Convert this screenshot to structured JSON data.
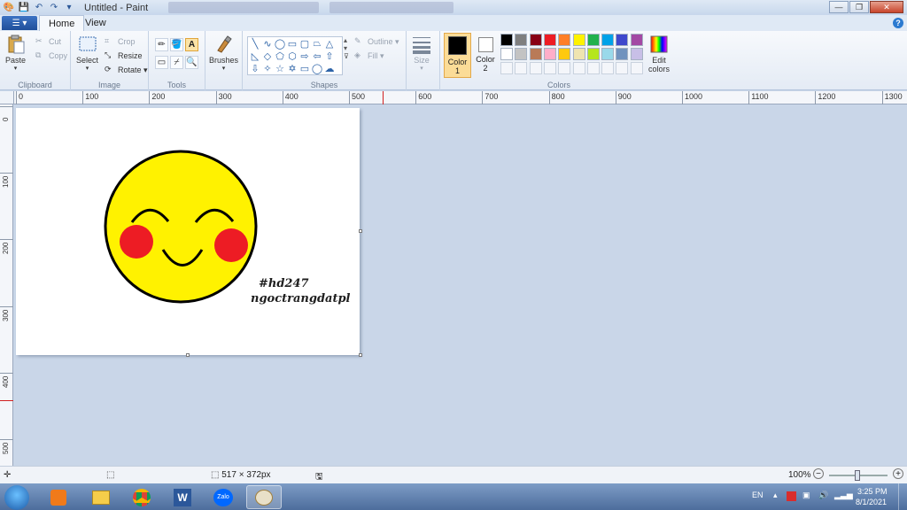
{
  "window": {
    "title": "Untitled - Paint"
  },
  "tabs": {
    "file_label": "▾",
    "home": "Home",
    "view": "View"
  },
  "ribbon": {
    "clipboard": {
      "label": "Clipboard",
      "paste": "Paste",
      "cut": "Cut",
      "copy": "Copy"
    },
    "image": {
      "label": "Image",
      "select": "Select",
      "crop": "Crop",
      "resize": "Resize",
      "rotate": "Rotate"
    },
    "tools": {
      "label": "Tools"
    },
    "brushes": {
      "label": "Brushes"
    },
    "shapes": {
      "label": "Shapes",
      "outline": "Outline",
      "fill": "Fill"
    },
    "size": {
      "label": "Size"
    },
    "colors": {
      "label": "Colors",
      "color1": "Color",
      "color1_num": "1",
      "color2": "Color",
      "color2_num": "2",
      "edit": "Edit",
      "edit2": "colors",
      "color1_value": "#000000",
      "color2_value": "#ffffff",
      "palette": [
        "#000000",
        "#7f7f7f",
        "#880015",
        "#ed1c24",
        "#ff7f27",
        "#fff200",
        "#22b14c",
        "#00a2e8",
        "#3f48cc",
        "#a349a4",
        "#ffffff",
        "#c3c3c3",
        "#b97a57",
        "#ffaec9",
        "#ffc90e",
        "#efe4b0",
        "#b5e61d",
        "#99d9ea",
        "#7092be",
        "#c8bfe7"
      ]
    }
  },
  "ruler": {
    "h_ticks": [
      "0",
      "100",
      "200",
      "300",
      "400",
      "500",
      "600",
      "700",
      "800",
      "900",
      "1000",
      "1100",
      "1200",
      "1300"
    ],
    "v_ticks": [
      "0",
      "100",
      "200",
      "300",
      "400",
      "500"
    ]
  },
  "drawing": {
    "line1": "#hd247",
    "line2": "ngoctrangdatpl"
  },
  "status": {
    "dimensions": "517 × 372px",
    "zoom": "100%"
  },
  "taskbar": {
    "lang": "EN",
    "time": "3:25 PM",
    "date": "8/1/2021",
    "zalo": "Zalo"
  }
}
